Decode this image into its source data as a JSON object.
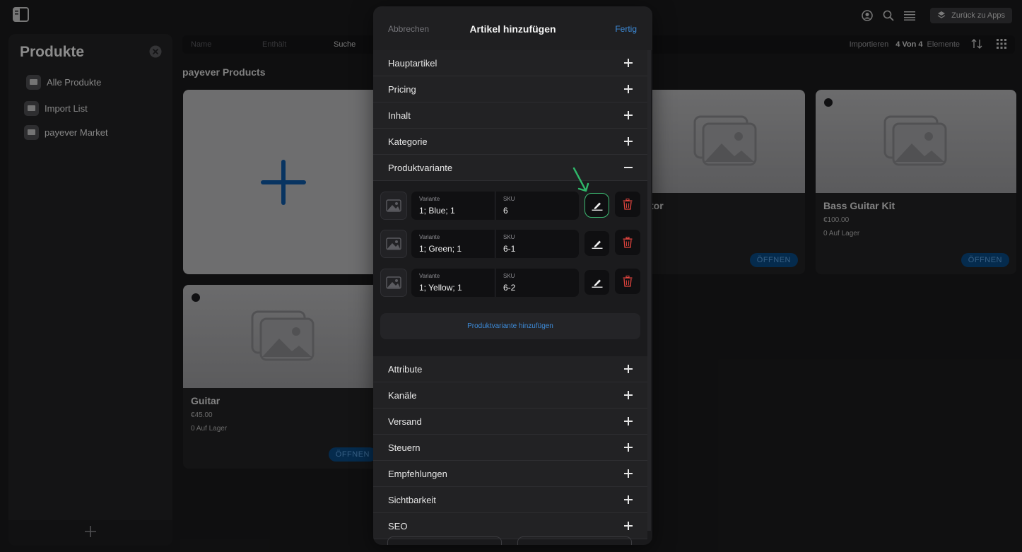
{
  "topbar": {
    "back_to_apps": "Zurück zu Apps"
  },
  "sidebar": {
    "title": "Produkte",
    "items": [
      {
        "label": "Alle Produkte"
      },
      {
        "label": "Import List"
      },
      {
        "label": "payever Market"
      }
    ]
  },
  "filterbar": {
    "name": "Name",
    "contains": "Enthält",
    "search": "Suche",
    "import": "Importieren",
    "count": "4 Von 4",
    "elements": "Elemente"
  },
  "main": {
    "group_title": "payever Products",
    "cards": [
      {
        "name": "",
        "price": "",
        "stock": "",
        "open": ""
      },
      {
        "name": "Guitar",
        "price": "€45.00",
        "stock": "0 Auf Lager",
        "open": "ÖFFNEN"
      },
      {
        "name": "tor",
        "price": "",
        "stock": "",
        "open": "ÖFFNEN"
      },
      {
        "name": "Bass Guitar Kit",
        "price": "€100.00",
        "stock": "0 Auf Lager",
        "open": "ÖFFNEN"
      }
    ]
  },
  "modal": {
    "cancel": "Abbrechen",
    "title": "Artikel hinzufügen",
    "done": "Fertig",
    "sections_top": [
      {
        "label": "Hauptartikel"
      },
      {
        "label": "Pricing"
      },
      {
        "label": "Inhalt"
      },
      {
        "label": "Kategorie"
      },
      {
        "label": "Produktvariante"
      }
    ],
    "variant_label": "Variante",
    "sku_label": "SKU",
    "variants": [
      {
        "variant": "1; Blue; 1",
        "sku": "6"
      },
      {
        "variant": "1; Green; 1",
        "sku": "6-1"
      },
      {
        "variant": "1; Yellow; 1",
        "sku": "6-2"
      }
    ],
    "add_variant": "Produktvariante hinzufügen",
    "sections_bottom": [
      {
        "label": "Attribute"
      },
      {
        "label": "Kanäle"
      },
      {
        "label": "Versand"
      },
      {
        "label": "Steuern"
      },
      {
        "label": "Empfehlungen"
      },
      {
        "label": "Sichtbarkeit"
      },
      {
        "label": "SEO"
      }
    ]
  },
  "colors": {
    "accent_blue": "#3d8bd9",
    "open_button_bg": "#0a4a86",
    "delete_red": "#e0443e",
    "focus_green": "#3dbb73"
  }
}
